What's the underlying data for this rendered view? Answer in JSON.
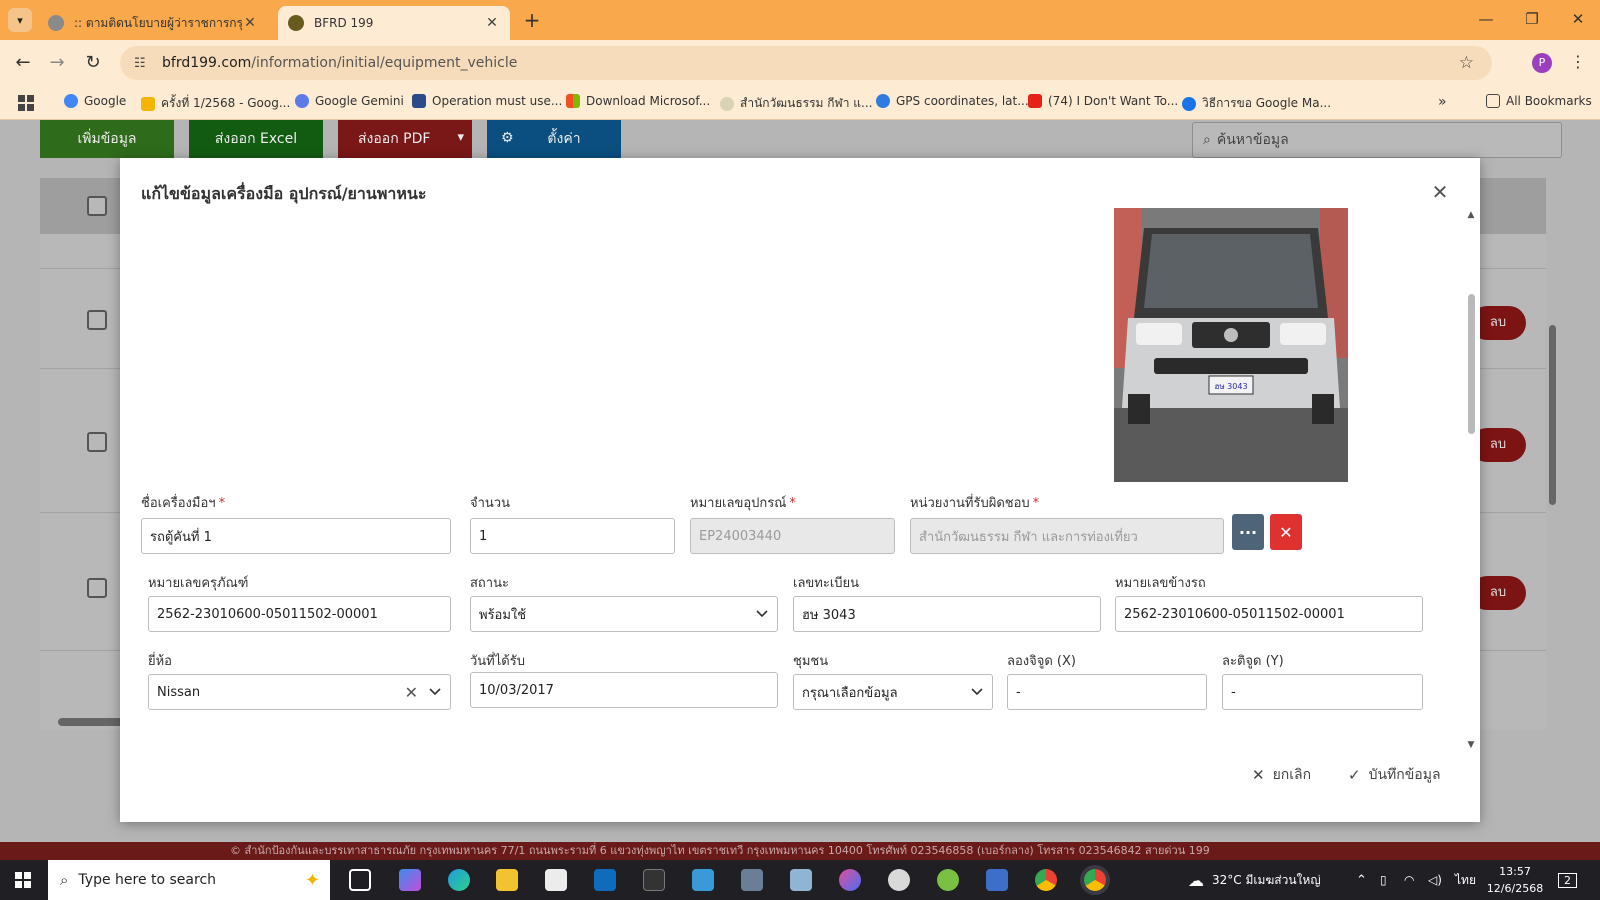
{
  "browser": {
    "tabs": [
      {
        "title": ":: ตามติดนโยบายผู้ว่าราชการกรุงเทพมหานคร"
      },
      {
        "title": "BFRD 199"
      }
    ],
    "url_host": "bfrd199.com",
    "url_path": "/information/initial/equipment_vehicle",
    "profile_initial": "P",
    "bookmarks": [
      {
        "label": "Google"
      },
      {
        "label": "ครั้งที่ 1/2568 - Goog..."
      },
      {
        "label": "Google Gemini"
      },
      {
        "label": "Operation must use..."
      },
      {
        "label": "Download Microsof..."
      },
      {
        "label": "สำนักวัฒนธรรม กีฬา แ..."
      },
      {
        "label": "GPS coordinates, lat..."
      },
      {
        "label": "(74) I Don't Want To..."
      },
      {
        "label": "วิธีการขอ Google Ma..."
      }
    ],
    "all_bookmarks_label": "All Bookmarks"
  },
  "page": {
    "toolbar": {
      "add_label": "เพิ่มข้อมูล",
      "excel_label": "ส่งออก Excel",
      "pdf_label": "ส่งออก PDF",
      "settings_label": "ตั้งค่า"
    },
    "search_placeholder": "ค้นหาข้อมูล",
    "delete_label": "ลบ",
    "footer_text": "© สำนักป้องกันและบรรเทาสาธารณภัย กรุงเทพมหานคร 77/1 ถนนพระรามที่ 6 แขวงทุ่งพญาไท เขตราชเทวี กรุงเทพมหานคร 10400 โทรศัพท์ 023546858 (เบอร์กลาง) โทรสาร 023546842 สายด่วน 199"
  },
  "modal": {
    "title": "แก้ไขข้อมูลเครื่องมือ อุปกรณ์/ยานพาหนะ",
    "fields": {
      "name": {
        "label": "ชื่อเครื่องมือฯ",
        "value": "รถตู้คันที่ 1"
      },
      "quantity": {
        "label": "จำนวน",
        "value": "1"
      },
      "equipment_no": {
        "label": "หมายเลขอุปกรณ์",
        "value": "EP24003440"
      },
      "agency": {
        "label": "หน่วยงานที่รับผิดชอบ",
        "value": "สำนักวัฒนธรรม กีฬา และการท่องเที่ยว"
      },
      "asset_no": {
        "label": "หมายเลขครุภัณฑ์",
        "value": "2562-23010600-05011502-00001"
      },
      "status": {
        "label": "สถานะ",
        "value": "พร้อมใช้"
      },
      "plate": {
        "label": "เลขทะเบียน",
        "value": "ฮษ 3043"
      },
      "side_no": {
        "label": "หมายเลขข้างรถ",
        "value": "2562-23010600-05011502-00001"
      },
      "brand": {
        "label": "ยี่ห้อ",
        "value": "Nissan"
      },
      "received_date": {
        "label": "วันที่ได้รับ",
        "value": "10/03/2017"
      },
      "community": {
        "label": "ชุมชน",
        "value": "กรุณาเลือกข้อมูล"
      },
      "longitude": {
        "label": "ลองจิจูด (X)",
        "value": "-"
      },
      "latitude": {
        "label": "ละติจูด (Y)",
        "value": "-"
      }
    },
    "cancel_label": "ยกเลิก",
    "save_label": "บันทึกข้อมูล",
    "photo_plate_text": "ฮษ 3043"
  },
  "taskbar": {
    "search_placeholder": "Type here to search",
    "weather": "32°C  มีเมฆส่วนใหญ่",
    "language": "ไทย",
    "time": "13:57",
    "date": "12/6/2568",
    "notification_count": "2"
  },
  "colors": {
    "chrome_tabbar": "#f9a94b",
    "chrome_toolbar": "#fdebd3",
    "btn_add": "#2e6b1b",
    "btn_excel": "#125c12",
    "btn_pdf": "#7a1717",
    "btn_settings": "#0b4f80",
    "more_button": "#4e6479",
    "clear_button": "#e03131"
  }
}
